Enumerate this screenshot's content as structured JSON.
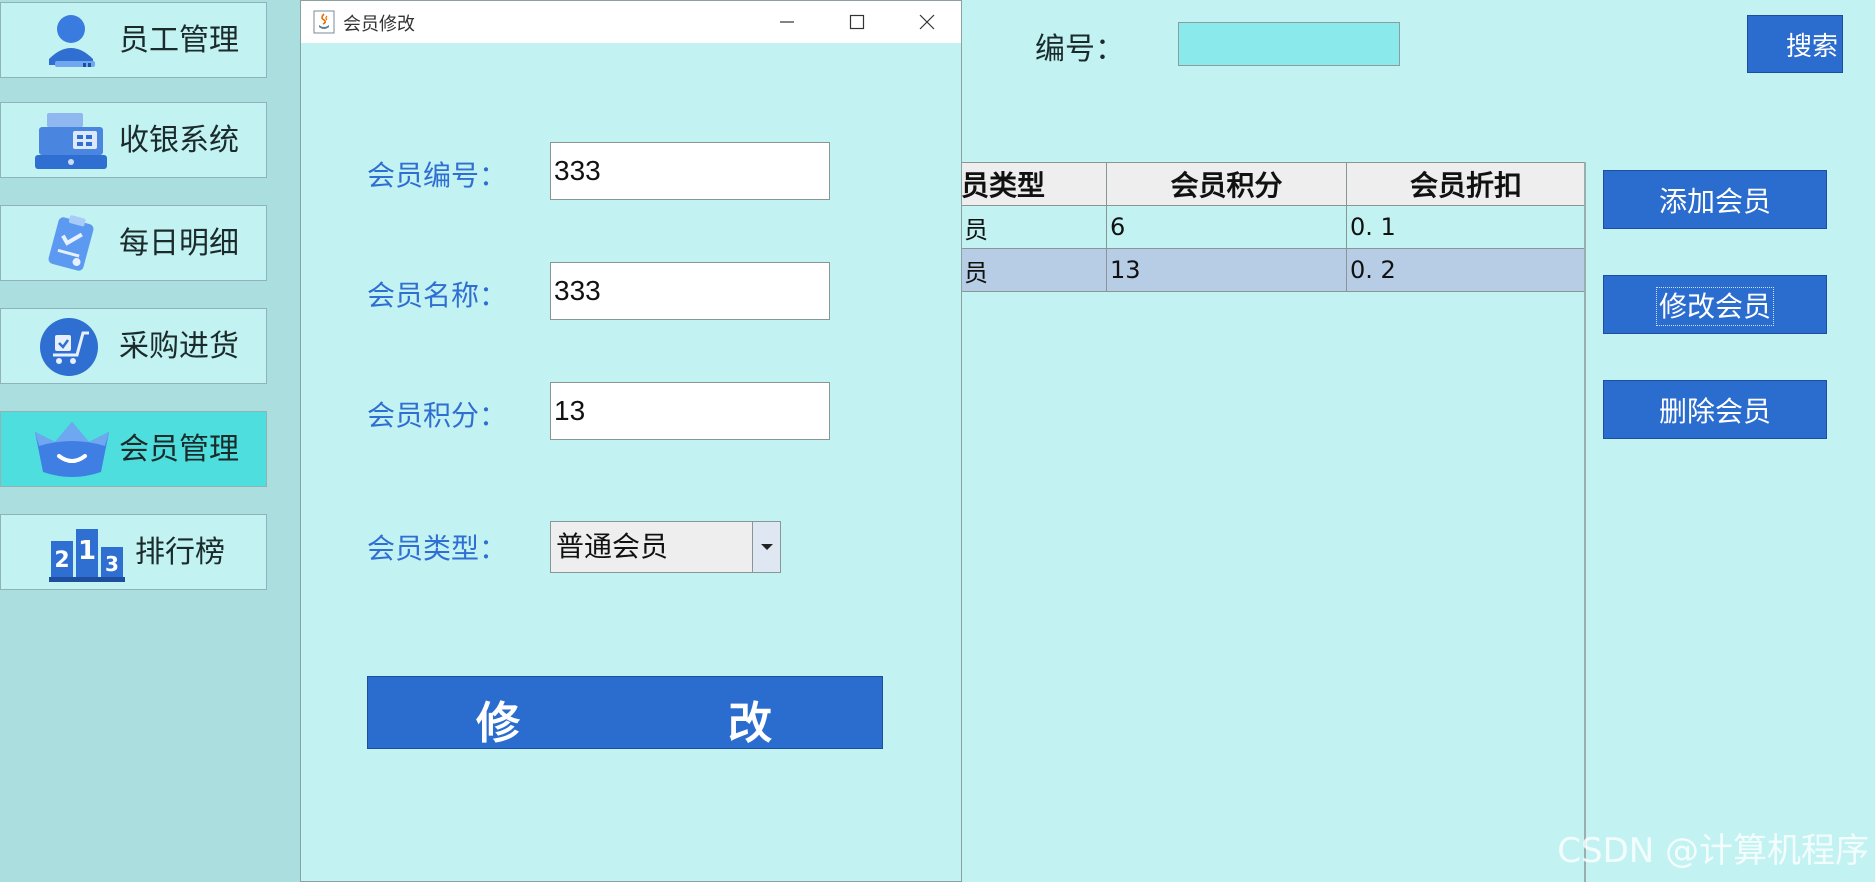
{
  "sidebar": {
    "items": [
      {
        "label": "员工管理",
        "icon": "employee-icon",
        "active": false
      },
      {
        "label": "收银系统",
        "icon": "cash-register-icon",
        "active": false
      },
      {
        "label": "每日明细",
        "icon": "clipboard-icon",
        "active": false
      },
      {
        "label": "采购进货",
        "icon": "purchase-cart-icon",
        "active": false
      },
      {
        "label": "会员管理",
        "icon": "crown-icon",
        "active": true
      },
      {
        "label": "排行榜",
        "icon": "podium-icon",
        "active": false
      }
    ]
  },
  "search": {
    "label": "编号：",
    "value": "",
    "button_label": "搜索"
  },
  "table": {
    "columns": [
      "员类型",
      "会员积分",
      "会员折扣"
    ],
    "rows": [
      {
        "type": "员",
        "points": "6",
        "discount": "0. 1",
        "selected": false
      },
      {
        "type": "员",
        "points": "13",
        "discount": "0. 2",
        "selected": true
      }
    ]
  },
  "actions": {
    "add": "添加会员",
    "edit": "修改会员",
    "delete": "删除会员"
  },
  "dialog": {
    "title": "会员修改",
    "fields": {
      "id_label": "会员编号：",
      "id_value": "333",
      "name_label": "会员名称：",
      "name_value": "333",
      "points_label": "会员积分：",
      "points_value": "13",
      "type_label": "会员类型：",
      "type_value": "普通会员"
    },
    "submit_char_1": "修",
    "submit_char_2": "改"
  },
  "watermark": "CSDN @计算机程序",
  "colors": {
    "background": "#c3f2f2",
    "sidebar": "#abdedf",
    "active_item": "#4fdede",
    "button": "#2b6ccf",
    "label_blue": "#2f6fd1",
    "selected_row": "#b6cde5"
  }
}
